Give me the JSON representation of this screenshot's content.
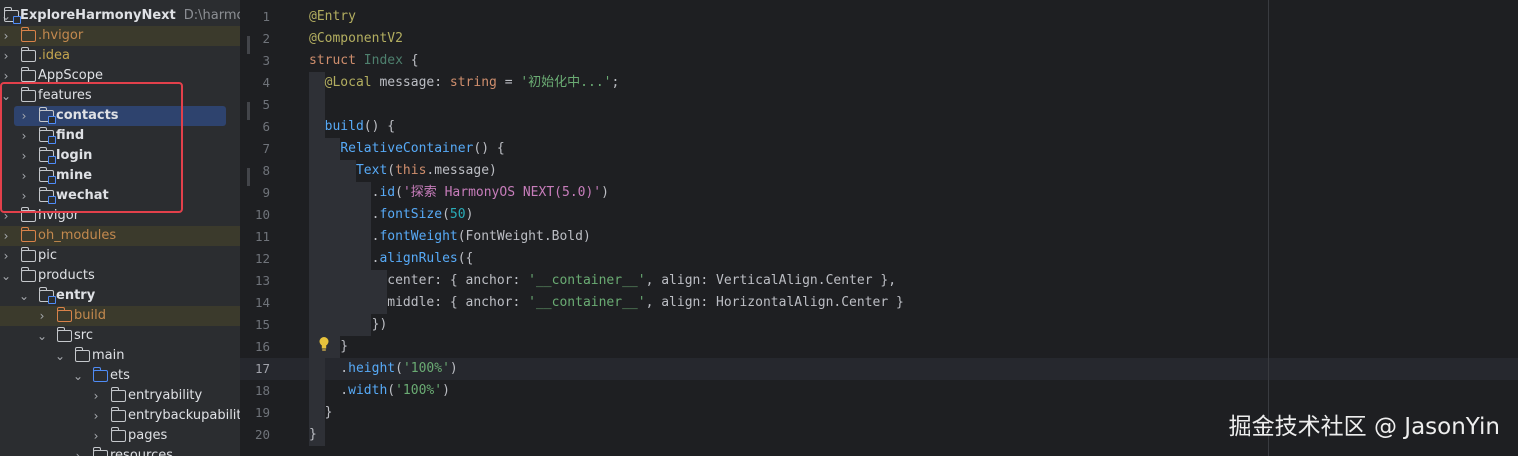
{
  "project": {
    "name": "ExploreHarmonyNext",
    "path": "D:\\harmonyO"
  },
  "tree": [
    {
      "label": ".hvigor",
      "depth": 0,
      "expanded": false,
      "style": "excluded"
    },
    {
      "label": ".idea",
      "depth": 0,
      "expanded": false,
      "style": "olive"
    },
    {
      "label": "AppScope",
      "depth": 0,
      "expanded": false,
      "style": "normal"
    },
    {
      "label": "features",
      "depth": 0,
      "expanded": true,
      "style": "normal"
    },
    {
      "label": "contacts",
      "depth": 1,
      "expanded": false,
      "style": "module",
      "selected": true
    },
    {
      "label": "find",
      "depth": 1,
      "expanded": false,
      "style": "module"
    },
    {
      "label": "login",
      "depth": 1,
      "expanded": false,
      "style": "module"
    },
    {
      "label": "mine",
      "depth": 1,
      "expanded": false,
      "style": "module"
    },
    {
      "label": "wechat",
      "depth": 1,
      "expanded": false,
      "style": "module"
    },
    {
      "label": "hvigor",
      "depth": 0,
      "expanded": false,
      "style": "normal"
    },
    {
      "label": "oh_modules",
      "depth": 0,
      "expanded": false,
      "style": "excluded"
    },
    {
      "label": "pic",
      "depth": 0,
      "expanded": false,
      "style": "normal"
    },
    {
      "label": "products",
      "depth": 0,
      "expanded": true,
      "style": "normal"
    },
    {
      "label": "entry",
      "depth": 1,
      "expanded": true,
      "style": "module"
    },
    {
      "label": "build",
      "depth": 2,
      "expanded": false,
      "style": "excluded"
    },
    {
      "label": "src",
      "depth": 2,
      "expanded": true,
      "style": "normal"
    },
    {
      "label": "main",
      "depth": 3,
      "expanded": true,
      "style": "normal"
    },
    {
      "label": "ets",
      "depth": 4,
      "expanded": true,
      "style": "source"
    },
    {
      "label": "entryability",
      "depth": 5,
      "expanded": false,
      "style": "normal"
    },
    {
      "label": "entrybackupability",
      "depth": 5,
      "expanded": false,
      "style": "normal"
    },
    {
      "label": "pages",
      "depth": 5,
      "expanded": false,
      "style": "normal"
    },
    {
      "label": "resources",
      "depth": 4,
      "expanded": false,
      "style": "normal"
    }
  ],
  "editor": {
    "current_line": 17,
    "lines": [
      {
        "n": "1",
        "tokens": [
          [
            "ann",
            "@Entry"
          ]
        ]
      },
      {
        "n": "2",
        "tokens": [
          [
            "ann",
            "@ComponentV2"
          ]
        ]
      },
      {
        "n": "3",
        "tokens": [
          [
            "kw",
            "struct "
          ],
          [
            "ty",
            "Index "
          ],
          [
            "txt",
            "{"
          ]
        ]
      },
      {
        "n": "4",
        "tokens": [
          [
            "txt",
            "  "
          ],
          [
            "ann",
            "@Local "
          ],
          [
            "txt",
            "message: "
          ],
          [
            "kw",
            "string"
          ],
          [
            "txt",
            " = "
          ],
          [
            "str",
            "'初始化中...'"
          ],
          [
            "txt",
            ";"
          ]
        ]
      },
      {
        "n": "5",
        "tokens": []
      },
      {
        "n": "6",
        "tokens": [
          [
            "txt",
            "  "
          ],
          [
            "fn",
            "build"
          ],
          [
            "txt",
            "() {"
          ]
        ]
      },
      {
        "n": "7",
        "tokens": [
          [
            "txt",
            "    "
          ],
          [
            "fn",
            "RelativeContainer"
          ],
          [
            "txt",
            "() {"
          ]
        ]
      },
      {
        "n": "8",
        "tokens": [
          [
            "txt",
            "      "
          ],
          [
            "fn",
            "Text"
          ],
          [
            "txt",
            "("
          ],
          [
            "kw",
            "this"
          ],
          [
            "txt",
            ".message)"
          ]
        ]
      },
      {
        "n": "9",
        "tokens": [
          [
            "txt",
            "        ."
          ],
          [
            "fn",
            "id"
          ],
          [
            "txt",
            "("
          ],
          [
            "strp",
            "'探索 HarmonyOS NEXT(5.0)'"
          ],
          [
            "txt",
            ")"
          ]
        ]
      },
      {
        "n": "10",
        "tokens": [
          [
            "txt",
            "        ."
          ],
          [
            "fn",
            "fontSize"
          ],
          [
            "txt",
            "("
          ],
          [
            "num",
            "50"
          ],
          [
            "txt",
            ")"
          ]
        ]
      },
      {
        "n": "11",
        "tokens": [
          [
            "txt",
            "        ."
          ],
          [
            "fn",
            "fontWeight"
          ],
          [
            "txt",
            "(FontWeight.Bold)"
          ]
        ]
      },
      {
        "n": "12",
        "tokens": [
          [
            "txt",
            "        ."
          ],
          [
            "fn",
            "alignRules"
          ],
          [
            "txt",
            "({"
          ]
        ]
      },
      {
        "n": "13",
        "tokens": [
          [
            "txt",
            "          center: { anchor: "
          ],
          [
            "str",
            "'__container__'"
          ],
          [
            "txt",
            ", align: VerticalAlign.Center },"
          ]
        ]
      },
      {
        "n": "14",
        "tokens": [
          [
            "txt",
            "          middle: { anchor: "
          ],
          [
            "str",
            "'__container__'"
          ],
          [
            "txt",
            ", align: HorizontalAlign.Center }"
          ]
        ]
      },
      {
        "n": "15",
        "tokens": [
          [
            "txt",
            "        })"
          ]
        ]
      },
      {
        "n": "16",
        "tokens": [
          [
            "txt",
            "    }"
          ]
        ]
      },
      {
        "n": "17",
        "tokens": [
          [
            "txt",
            "    ."
          ],
          [
            "fn",
            "height"
          ],
          [
            "txt",
            "("
          ],
          [
            "str",
            "'100%'"
          ],
          [
            "txt",
            ")"
          ]
        ]
      },
      {
        "n": "18",
        "tokens": [
          [
            "txt",
            "    ."
          ],
          [
            "fn",
            "width"
          ],
          [
            "txt",
            "("
          ],
          [
            "str",
            "'100%'"
          ],
          [
            "txt",
            ")"
          ]
        ]
      },
      {
        "n": "19",
        "tokens": [
          [
            "txt",
            "  }"
          ]
        ]
      },
      {
        "n": "20",
        "tokens": [
          [
            "txt",
            "}"
          ]
        ]
      }
    ]
  },
  "watermark": "掘金技术社区 @ JasonYin",
  "colors": {
    "sidebar_bg": "#2b2d30",
    "editor_bg": "#1e1f22",
    "selection": "#2e436e",
    "highlight_box": "#e2404b"
  },
  "icons": [
    "folder-icon",
    "module-folder-icon",
    "chevron-right-icon",
    "chevron-down-icon",
    "lightbulb-icon"
  ]
}
